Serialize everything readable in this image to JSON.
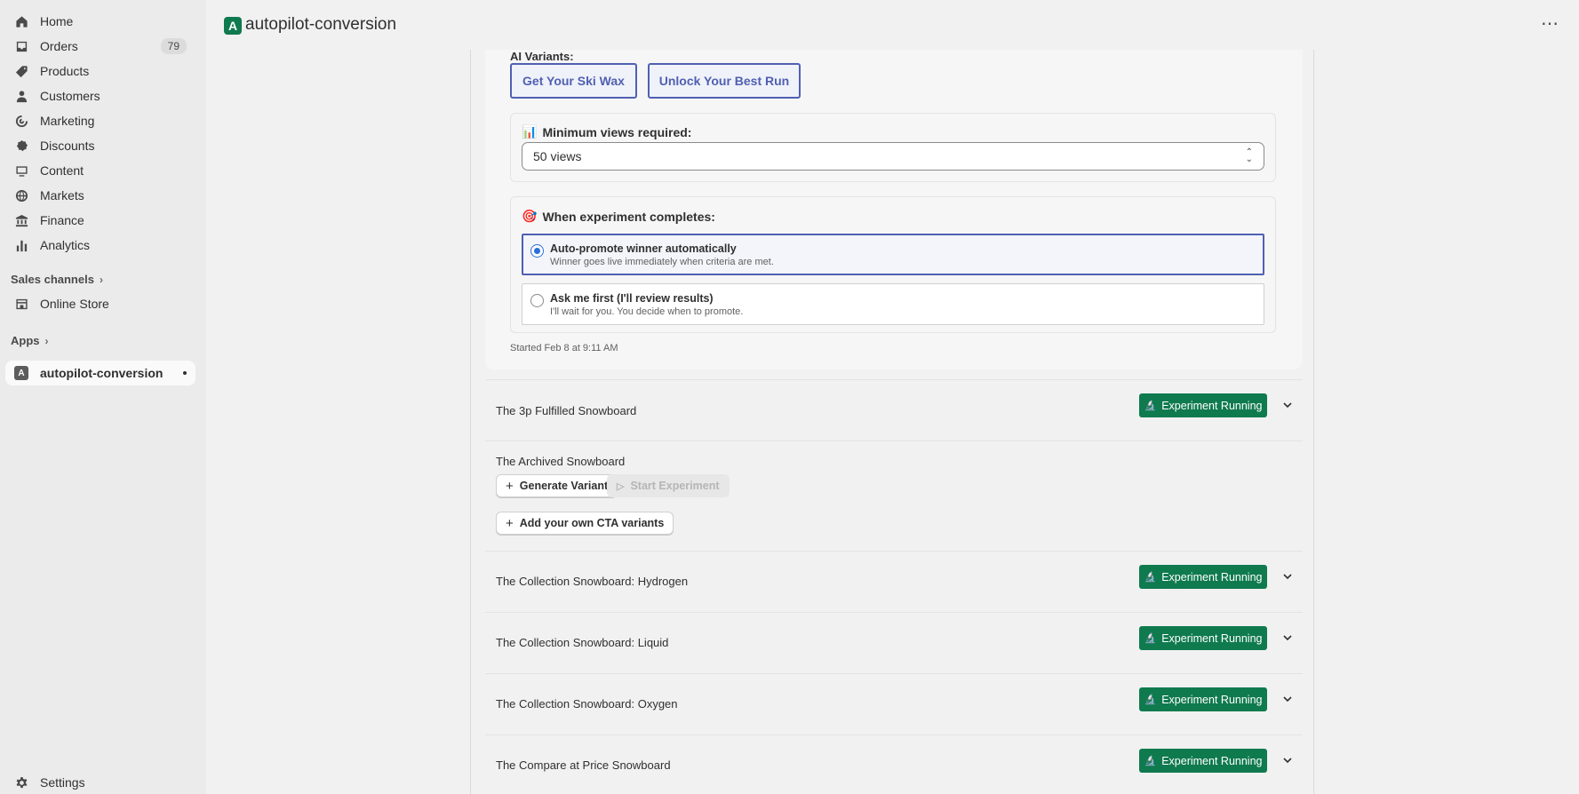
{
  "sidebar": {
    "items": [
      {
        "label": "Home",
        "icon": "home-icon"
      },
      {
        "label": "Orders",
        "icon": "inbox-icon",
        "badge": "79"
      },
      {
        "label": "Products",
        "icon": "tag-icon"
      },
      {
        "label": "Customers",
        "icon": "person-icon"
      },
      {
        "label": "Marketing",
        "icon": "target-icon"
      },
      {
        "label": "Discounts",
        "icon": "discount-icon"
      },
      {
        "label": "Content",
        "icon": "image-icon"
      },
      {
        "label": "Markets",
        "icon": "globe-icon"
      },
      {
        "label": "Finance",
        "icon": "bank-icon"
      },
      {
        "label": "Analytics",
        "icon": "bar-chart-icon"
      }
    ],
    "sales_channels_label": "Sales channels",
    "online_store_label": "Online Store",
    "apps_label": "Apps",
    "app_item_label": "autopilot-conversion",
    "app_item_initial": "A",
    "settings_label": "Settings"
  },
  "topbar": {
    "app_initial": "A",
    "title": "autopilot-conversion",
    "more_label": "⋯"
  },
  "expanded": {
    "variants_label": "AI Variants:",
    "variants": [
      "Get Your Ski Wax",
      "Unlock Your Best Run"
    ],
    "min_views_title": "Minimum views required:",
    "min_views_value": "50 views",
    "completion_title": "When experiment completes:",
    "options": [
      {
        "main": "Auto-promote winner automatically",
        "sub": "Winner goes live immediately when criteria are met.",
        "selected": true
      },
      {
        "main": "Ask me first (I'll review results)",
        "sub": "I'll wait for you. You decide when to promote.",
        "selected": false
      }
    ],
    "started_text": "Started Feb 8 at 9:11 AM"
  },
  "products": [
    {
      "name": "The 3p Fulfilled Snowboard",
      "status": "Experiment Running"
    },
    {
      "name": "The Archived Snowboard",
      "generate_label": "Generate Variant",
      "start_label": "Start Experiment",
      "add_cta_label": "Add your own CTA variants"
    },
    {
      "name": "The Collection Snowboard: Hydrogen",
      "status": "Experiment Running"
    },
    {
      "name": "The Collection Snowboard: Liquid",
      "status": "Experiment Running"
    },
    {
      "name": "The Collection Snowboard: Oxygen",
      "status": "Experiment Running"
    },
    {
      "name": "The Compare at Price Snowboard",
      "status": "Experiment Running"
    }
  ],
  "colors": {
    "accent": "#0f7a4e",
    "selected_border": "#5060b0",
    "radio": "#2a6fd8"
  }
}
